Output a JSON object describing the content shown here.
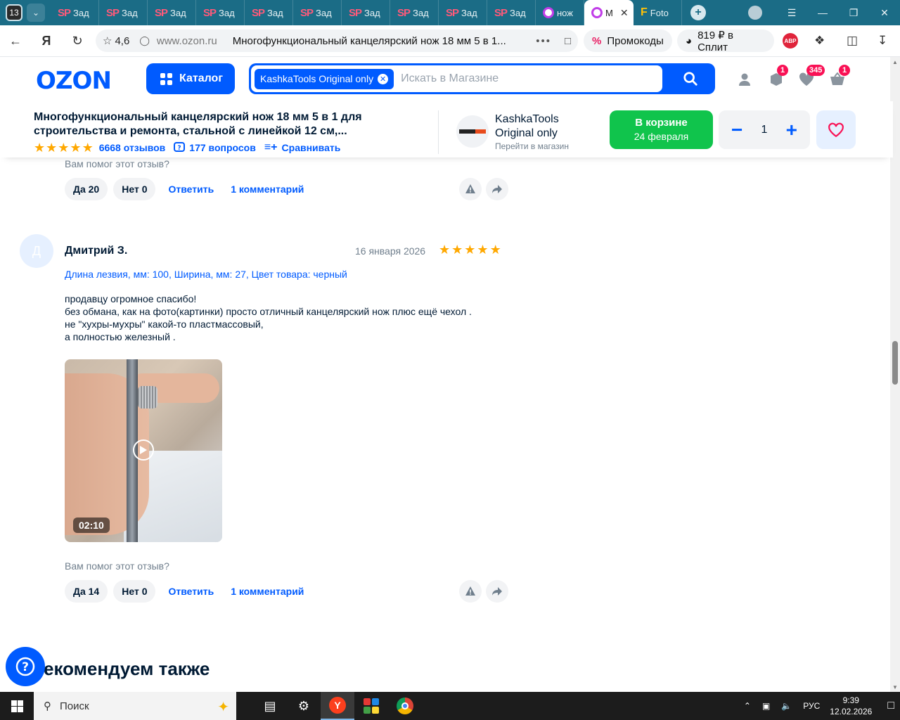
{
  "browser": {
    "tab_count": "13",
    "tabs": [
      {
        "label": "Зад",
        "icon": "sp"
      },
      {
        "label": "Зад",
        "icon": "sp"
      },
      {
        "label": "Зад",
        "icon": "sp"
      },
      {
        "label": "Зад",
        "icon": "sp"
      },
      {
        "label": "Зад",
        "icon": "sp"
      },
      {
        "label": "Зад",
        "icon": "sp"
      },
      {
        "label": "Зад",
        "icon": "sp"
      },
      {
        "label": "Зад",
        "icon": "sp"
      },
      {
        "label": "Зад",
        "icon": "sp"
      },
      {
        "label": "Зад",
        "icon": "sp"
      },
      {
        "label": "нож",
        "icon": "ozon"
      },
      {
        "label": "М",
        "icon": "ozon",
        "active": true
      },
      {
        "label": "Foto",
        "icon": "f"
      }
    ],
    "sp_icon_text": "SP",
    "f_icon_text": "F",
    "rating": "4,6",
    "domain": "www.ozon.ru",
    "page_title": "Многофункциональный канцелярский нож 18 мм 5 в 1...",
    "promo_label": "Промокоды",
    "split_label": "819 ₽ в Сплит",
    "abp_label": "ABP"
  },
  "header": {
    "logo": "OZON",
    "catalog_label": "Каталог",
    "search_chip": "KashkaTools Original only",
    "search_placeholder": "Искать в Магазине",
    "badges": {
      "orders": "1",
      "favorites": "345",
      "cart": "1"
    }
  },
  "product": {
    "title_line1": "Многофункциональный канцелярский нож 18 мм 5 в 1 для",
    "title_line2": "строительства и ремонта, стальной с линейкой 12 см,...",
    "reviews": "6668 отзывов",
    "questions": "177 вопросов",
    "compare": "Сравнивать",
    "rating_stars": 5,
    "shop_name_line1": "KashkaTools",
    "shop_name_line2": "Original only",
    "shop_link": "Перейти в магазин",
    "cart_line1": "В корзине",
    "cart_line2": "24 февраля",
    "quantity": "1"
  },
  "reviews": {
    "prev": {
      "helpful_q": "Вам помог этот отзыв?",
      "yes": "Да 20",
      "no": "Нет 0",
      "reply": "Ответить",
      "comments": "1 комментарий"
    },
    "current": {
      "avatar_letter": "Д",
      "author": "Дмитрий З.",
      "date": "16 января 2026",
      "stars": 5,
      "variant": "Длина лезвия, мм: 100, Ширина, мм: 27, Цвет товара: черный",
      "text": [
        "продавцу огромное спасибо!",
        "без обмана, как на фото(картинки) просто отличный канцелярский нож плюс ещё чехол .",
        "не \"хухры-мухры\" какой-то пластмассовый,",
        "а полностью железный ."
      ],
      "video_duration": "02:10",
      "helpful_q": "Вам помог этот отзыв?",
      "yes": "Да 14",
      "no": "Нет 0",
      "reply": "Ответить",
      "comments": "1 комментарий"
    }
  },
  "recommend_title": "екомендуем также",
  "taskbar": {
    "search_label": "Поиск",
    "lang": "РУС",
    "time": "9:39",
    "date": "12.02.2026"
  },
  "colors": {
    "brand": "#005bff",
    "green": "#10c44c",
    "star": "#ffa800",
    "badge": "#f91155"
  }
}
